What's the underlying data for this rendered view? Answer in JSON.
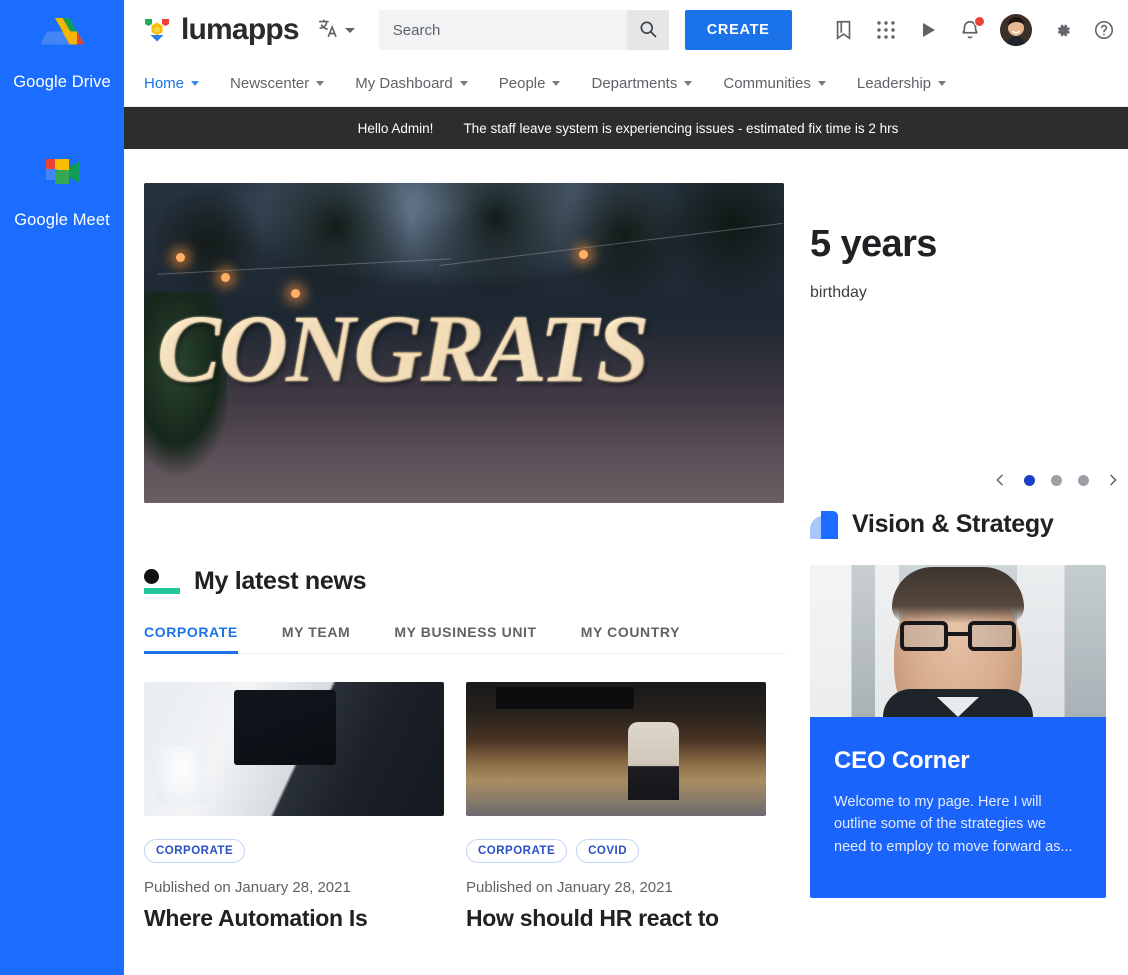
{
  "left_rail": {
    "apps": [
      {
        "label": "Google Drive",
        "icon": "google-drive-icon"
      },
      {
        "label": "Google Meet",
        "icon": "google-meet-icon"
      }
    ]
  },
  "header": {
    "brand": "lumapps",
    "brand_icon": "lumapps-logo-icon",
    "language_icon": "translate-icon",
    "search": {
      "placeholder": "Search",
      "value": "",
      "icon": "search-icon"
    },
    "create_label": "CREATE",
    "icons": [
      {
        "name": "bookmark-icon"
      },
      {
        "name": "apps-grid-icon"
      },
      {
        "name": "play-icon"
      },
      {
        "name": "notifications-bell-icon",
        "badge": true
      },
      {
        "name": "avatar"
      },
      {
        "name": "settings-gear-icon"
      },
      {
        "name": "help-circle-icon"
      }
    ]
  },
  "nav": {
    "items": [
      {
        "label": "Home",
        "active": true
      },
      {
        "label": "Newscenter",
        "active": false
      },
      {
        "label": "My Dashboard",
        "active": false
      },
      {
        "label": "People",
        "active": false
      },
      {
        "label": "Departments",
        "active": false
      },
      {
        "label": "Communities",
        "active": false
      },
      {
        "label": "Leadership",
        "active": false
      }
    ]
  },
  "announcement": {
    "greeting": "Hello Admin!",
    "message": "The staff leave system is experiencing issues - estimated fix time is 2 hrs"
  },
  "hero": {
    "image_alt": "CONGRATS gold balloons strung outdoors at dusk",
    "balloon_text": "CONGRATS",
    "title": "5 years",
    "subtitle": "birthday",
    "prev_icon": "chevron-left-icon",
    "next_icon": "chevron-right-icon",
    "dots": [
      {
        "active": true
      },
      {
        "active": false
      },
      {
        "active": false
      }
    ]
  },
  "news": {
    "title": "My latest news",
    "marker_icon": "dot-underline-icon",
    "tabs": [
      {
        "label": "CORPORATE",
        "active": true
      },
      {
        "label": "MY TEAM",
        "active": false
      },
      {
        "label": "MY BUSINESS UNIT",
        "active": false
      },
      {
        "label": "MY COUNTRY",
        "active": false
      }
    ],
    "cards": [
      {
        "image_alt": "Person holding a tablet showing stock charts beside a laptop",
        "chips": [
          "CORPORATE"
        ],
        "date": "Published on January 28, 2021",
        "title": "Where Automation Is"
      },
      {
        "image_alt": "Woman in face mask sitting in an empty airport check-in hall",
        "chips": [
          "CORPORATE",
          "COVID"
        ],
        "date": "Published on January 28, 2021",
        "title": "How should HR react to"
      }
    ]
  },
  "vision": {
    "title": "Vision & Strategy",
    "marker_icon": "vision-shape-icon",
    "card": {
      "image_alt": "Portrait of a man with glasses in an office",
      "title": "CEO Corner",
      "description": "Welcome to my page. Here I will outline some of the strategies we need to employ to move forward as..."
    }
  },
  "colors": {
    "rail_blue": "#1a6dff",
    "accent_blue": "#1a73e8",
    "announce_bg": "#2d2d2d",
    "news_marker_green": "#23c79a",
    "ceo_card_blue": "#1a63fb",
    "chip_text": "#2b4fc4",
    "notification_red": "#ea4335"
  }
}
